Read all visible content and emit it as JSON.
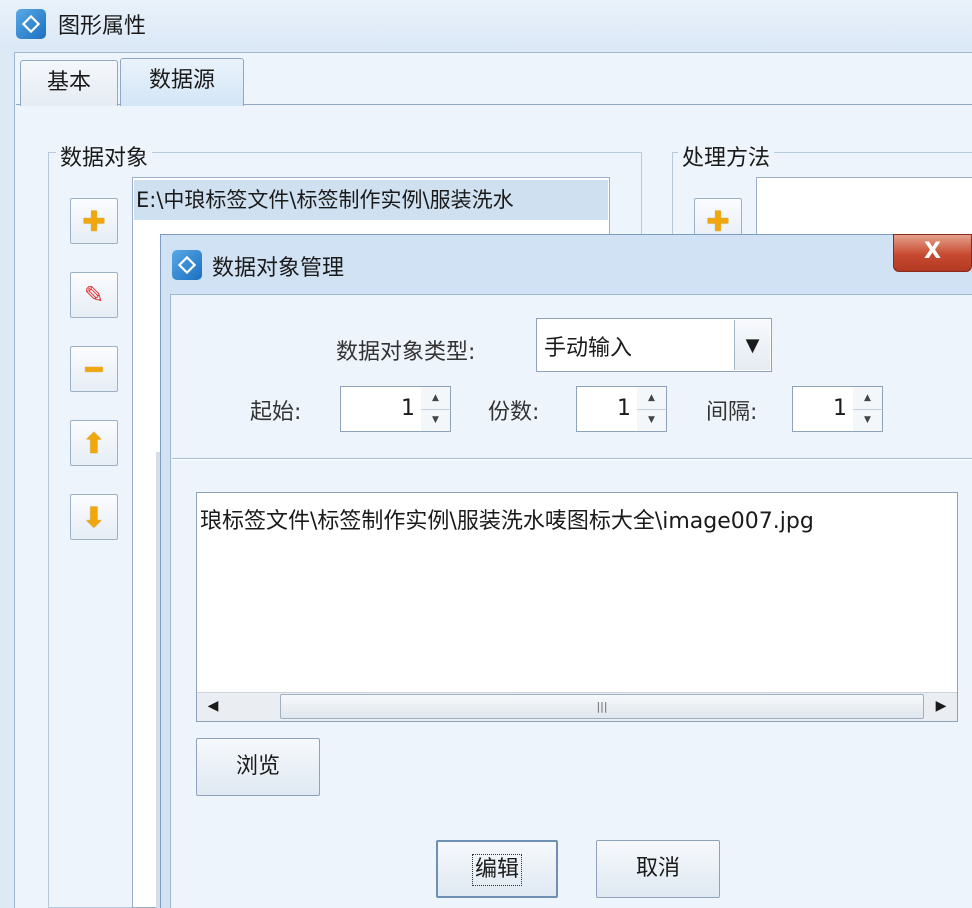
{
  "window": {
    "title": "图形属性"
  },
  "tabs": [
    {
      "label": "基本"
    },
    {
      "label": "数据源"
    }
  ],
  "data_object_group": {
    "label": "数据对象",
    "list_item": "E:\\中琅标签文件\\标签制作实例\\服装洗水"
  },
  "method_group": {
    "label": "处理方法"
  },
  "dialog": {
    "title": "数据对象管理",
    "close_label": "X",
    "type_label": "数据对象类型:",
    "type_value": "手动输入",
    "start_label": "起始:",
    "start_value": "1",
    "copies_label": "份数:",
    "copies_value": "1",
    "interval_label": "间隔:",
    "interval_value": "1",
    "path_text": "琅标签文件\\标签制作实例\\服装洗水唛图标大全\\image007.jpg",
    "browse_label": "浏览",
    "edit_label": "编辑",
    "cancel_label": "取消"
  },
  "icons": {
    "add": "plus-icon",
    "edit": "pencil-icon",
    "remove": "minus-icon",
    "up": "arrow-up-icon",
    "down": "arrow-down-icon"
  }
}
